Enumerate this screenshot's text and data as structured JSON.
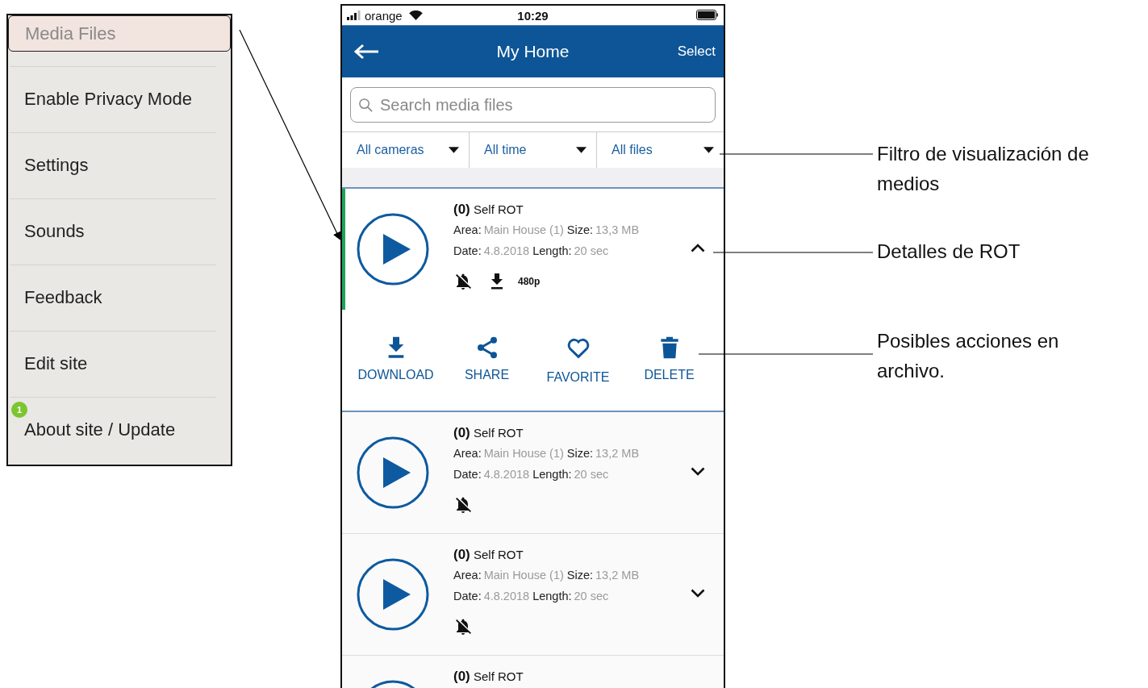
{
  "menu": {
    "items": [
      {
        "label": "Media Files",
        "selected": true
      },
      {
        "label": "Enable Privacy Mode",
        "selected": false
      },
      {
        "label": "Settings",
        "selected": false
      },
      {
        "label": "Sounds",
        "selected": false
      },
      {
        "label": "Feedback",
        "selected": false
      },
      {
        "label": "Edit site",
        "selected": false
      },
      {
        "label": "About site / Update",
        "selected": false,
        "badge": "1"
      }
    ]
  },
  "phone": {
    "status_bar": {
      "carrier": "orange",
      "time": "10:29"
    },
    "header": {
      "title": "My Home",
      "action": "Select"
    },
    "search": {
      "placeholder": "Search media files"
    },
    "filters": [
      {
        "label": "All cameras"
      },
      {
        "label": "All time"
      },
      {
        "label": "All files"
      }
    ],
    "files": [
      {
        "title": "**(0)** Self ROT",
        "area_label": "Area:",
        "area": "Main House (1)",
        "size_label": "Size:",
        "size": "13,3 MB",
        "date_label": "Date:",
        "date": "4.8.2018",
        "length_label": "Length:",
        "length": "20 sec",
        "expanded": true,
        "downloaded": true,
        "resolution": "480p",
        "actions": [
          {
            "kind": "download",
            "label": "DOWNLOAD"
          },
          {
            "kind": "share",
            "label": "SHARE"
          },
          {
            "kind": "favorite",
            "label": "FAVORITE"
          },
          {
            "kind": "delete",
            "label": "DELETE"
          }
        ]
      },
      {
        "title": "**(0)** Self ROT",
        "area_label": "Area:",
        "area": "Main House (1)",
        "size_label": "Size:",
        "size": "13,2 MB",
        "date_label": "Date:",
        "date": "4.8.2018",
        "length_label": "Length:",
        "length": "20 sec",
        "expanded": false,
        "downloaded": false
      },
      {
        "title": "**(0)** Self ROT",
        "area_label": "Area:",
        "area": "Main House (1)",
        "size_label": "Size:",
        "size": "13,2 MB",
        "date_label": "Date:",
        "date": "4.8.2018",
        "length_label": "Length:",
        "length": "20 sec",
        "expanded": false,
        "downloaded": false
      },
      {
        "title": "**(0)** Self ROT"
      }
    ]
  },
  "callouts": [
    {
      "text": "Filtro de visualización de medios"
    },
    {
      "text": "Detalles de ROT"
    },
    {
      "text": "Posibles acciones en archivo."
    }
  ]
}
